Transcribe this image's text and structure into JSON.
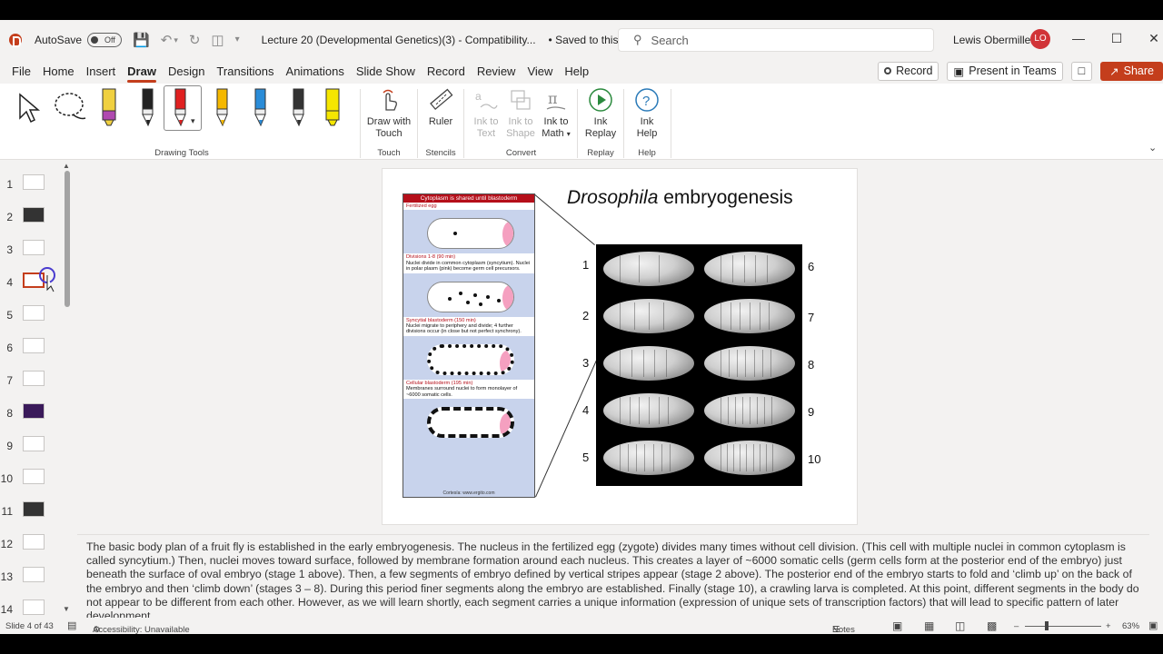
{
  "titlebar": {
    "autosave_label": "AutoSave",
    "autosave_state": "Off",
    "document_title": "Lecture 20 (Developmental Genetics)(3)  -  Compatibility...",
    "saved_state": "• Saved to this PC",
    "search_placeholder": "Search",
    "user_name": "Lewis Obermiller",
    "user_initials": "LO"
  },
  "menu": {
    "tabs": [
      "File",
      "Home",
      "Insert",
      "Draw",
      "Design",
      "Transitions",
      "Animations",
      "Slide Show",
      "Record",
      "Review",
      "View",
      "Help"
    ],
    "active_tab": "Draw",
    "record_label": "Record",
    "present_label": "Present in Teams",
    "share_label": "Share"
  },
  "ribbon": {
    "drawing_tools_label": "Drawing Tools",
    "draw_with_touch": "Draw with Touch",
    "touch_label": "Touch",
    "ruler": "Ruler",
    "stencils_label": "Stencils",
    "ink_to_text": "Ink to Text",
    "ink_to_shape": "Ink to Shape",
    "ink_to_math": "Ink to Math",
    "convert_label": "Convert",
    "ink_replay": "Ink Replay",
    "replay_label": "Replay",
    "ink_help": "Ink Help",
    "help_label": "Help",
    "pen_colors": [
      "#f0d040",
      "#222222",
      "#e02020",
      "#f5b800",
      "#2a8cd8",
      "#333333",
      "#f5e600"
    ]
  },
  "thumbnails": {
    "numbers": [
      "1",
      "2",
      "3",
      "4",
      "5",
      "6",
      "7",
      "8",
      "9",
      "10",
      "11",
      "12",
      "13",
      "14"
    ],
    "selected": "4"
  },
  "slide": {
    "title_italic": "Drosophila",
    "title_rest": " embryogenesis",
    "figure": {
      "header": "Cytoplasm is shared until blastoderm",
      "captions": [
        {
          "heading": "Fertilized egg",
          "body": ""
        },
        {
          "heading": "Divisions 1-8 (90 min)",
          "body": "Nuclei divide in common cytoplasm (syncytium). Nuclei in polar plasm (pink) become germ cell precursors."
        },
        {
          "heading": "Syncytial blastoderm (150 min)",
          "body": "Nuclei migrate to periphery and divide; 4 further divisions occur (in close but not perfect synchrony)."
        },
        {
          "heading": "Cellular blastoderm (195 min)",
          "body": "Membranes surround nuclei to form monolayer of ~6000 somatic cells."
        }
      ],
      "credit": "Cortesía: www.ergito.com"
    },
    "stages_left": [
      "1",
      "2",
      "3",
      "4",
      "5"
    ],
    "stages_right": [
      "6",
      "7",
      "8",
      "9",
      "10"
    ]
  },
  "notes": {
    "text": "The basic body plan of a fruit fly is established in the early embryogenesis. The nucleus in the fertilized egg (zygote) divides many times without cell division. (This cell with multiple nuclei in common cytoplasm is called syncytium.) Then, nuclei moves toward surface, followed by membrane formation around each nucleus. This creates a layer of ~6000 somatic cells (germ cells form at the posterior end of the embryo) just beneath the surface of oval embryo (stage 1 above). Then, a few segments of embryo defined by vertical stripes appear (stage 2 above). The posterior end of the embryo starts to fold and ‘climb up’ on the back of the embryo and then ‘climb down’ (stages 3 – 8). During this period finer segments along the embryo are established. Finally (stage 10), a crawling larva is completed. At this point, different segments in the body do not appear to be different from each other. However, as we will learn shortly, each segment carries a unique information (expression of unique sets of transcription factors) that will lead to specific pattern of later development."
  },
  "status": {
    "slide_info": "Slide 4 of 43",
    "accessibility": "Accessibility: Unavailable",
    "notes_label": "Notes",
    "zoom": "63%"
  }
}
